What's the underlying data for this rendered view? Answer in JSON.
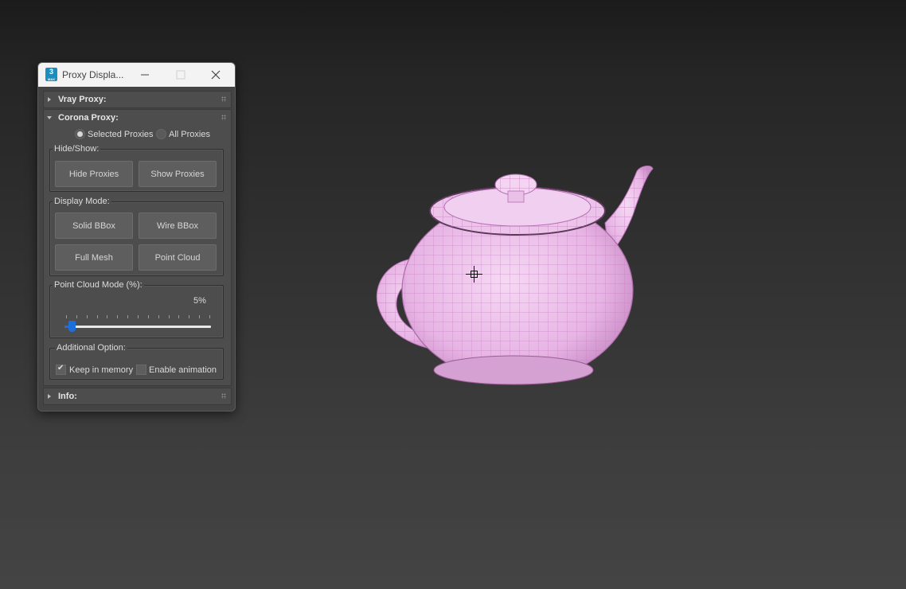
{
  "window": {
    "title": "Proxy Displa...",
    "app_icon_label": "3",
    "app_icon_sublabel": "MAX"
  },
  "rollouts": {
    "vray": {
      "title": "Vray Proxy:",
      "expanded": false
    },
    "corona": {
      "title": "Corona Proxy:",
      "expanded": true,
      "scope": {
        "selected_label": "Selected Proxies",
        "all_label": "All Proxies",
        "selected": "Selected Proxies"
      },
      "hide_show": {
        "title": "Hide/Show:",
        "hide_label": "Hide Proxies",
        "show_label": "Show Proxies"
      },
      "display_mode": {
        "title": "Display Mode:",
        "solid_bbox_label": "Solid BBox",
        "wire_bbox_label": "Wire BBox",
        "full_mesh_label": "Full Mesh",
        "point_cloud_label": "Point Cloud"
      },
      "point_cloud_mode": {
        "title": "Point Cloud Mode (%):",
        "value_text": "5%",
        "value_percent": 5
      },
      "additional": {
        "title": "Additional Option:",
        "keep_in_memory_label": "Keep in memory",
        "keep_in_memory_checked": true,
        "enable_animation_label": "Enable animation",
        "enable_animation_checked": false
      }
    },
    "info": {
      "title": "Info:",
      "expanded": false
    }
  },
  "colors": {
    "teapot_fill": "#e9b8e6",
    "teapot_wire": "#c67ec4",
    "slider_accent": "#1e6fd9"
  }
}
